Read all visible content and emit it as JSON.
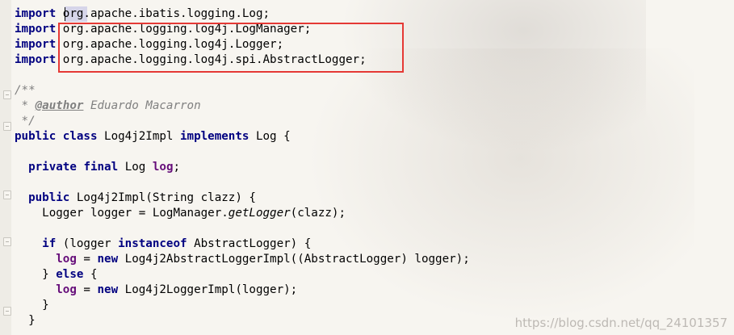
{
  "editor": {
    "lines": [
      [
        {
          "t": "import",
          "c": "kw"
        },
        {
          "t": " org.apache.ibatis.logging.Log;",
          "c": ""
        }
      ],
      [
        {
          "t": "import",
          "c": "kw"
        },
        {
          "t": " org.apache.logging.log4j.LogManager;",
          "c": ""
        }
      ],
      [
        {
          "t": "import",
          "c": "kw"
        },
        {
          "t": " org.apache.logging.log4j.Logger;",
          "c": ""
        }
      ],
      [
        {
          "t": "import",
          "c": "kw"
        },
        {
          "t": " org.apache.logging.log4j.spi.AbstractLogger;",
          "c": ""
        }
      ],
      [],
      [
        {
          "t": "/**",
          "c": "cmt"
        }
      ],
      [
        {
          "t": " * ",
          "c": "cmt"
        },
        {
          "t": "@author",
          "c": "tag"
        },
        {
          "t": " Eduardo Macarron",
          "c": "cmt"
        }
      ],
      [
        {
          "t": " */",
          "c": "cmt"
        }
      ],
      [
        {
          "t": "public",
          "c": "kw"
        },
        {
          "t": " ",
          "c": ""
        },
        {
          "t": "class",
          "c": "kw"
        },
        {
          "t": " Log4j2Impl ",
          "c": ""
        },
        {
          "t": "implements",
          "c": "kw"
        },
        {
          "t": " Log {",
          "c": ""
        }
      ],
      [],
      [
        {
          "t": "  ",
          "c": ""
        },
        {
          "t": "private",
          "c": "kw"
        },
        {
          "t": " ",
          "c": ""
        },
        {
          "t": "final",
          "c": "kw"
        },
        {
          "t": " Log ",
          "c": ""
        },
        {
          "t": "log",
          "c": "field"
        },
        {
          "t": ";",
          "c": ""
        }
      ],
      [],
      [
        {
          "t": "  ",
          "c": ""
        },
        {
          "t": "public",
          "c": "kw"
        },
        {
          "t": " Log4j2Impl(String clazz) {",
          "c": ""
        }
      ],
      [
        {
          "t": "    Logger logger = LogManager.",
          "c": ""
        },
        {
          "t": "getLogger",
          "c": "call"
        },
        {
          "t": "(clazz);",
          "c": ""
        }
      ],
      [],
      [
        {
          "t": "    ",
          "c": ""
        },
        {
          "t": "if",
          "c": "kw"
        },
        {
          "t": " (logger ",
          "c": ""
        },
        {
          "t": "instanceof",
          "c": "kw"
        },
        {
          "t": " AbstractLogger) {",
          "c": ""
        }
      ],
      [
        {
          "t": "      ",
          "c": ""
        },
        {
          "t": "log",
          "c": "field"
        },
        {
          "t": " = ",
          "c": ""
        },
        {
          "t": "new",
          "c": "kw"
        },
        {
          "t": " Log4j2AbstractLoggerImpl((AbstractLogger) logger);",
          "c": ""
        }
      ],
      [
        {
          "t": "    } ",
          "c": ""
        },
        {
          "t": "else",
          "c": "kw"
        },
        {
          "t": " {",
          "c": ""
        }
      ],
      [
        {
          "t": "      ",
          "c": ""
        },
        {
          "t": "log",
          "c": "field"
        },
        {
          "t": " = ",
          "c": ""
        },
        {
          "t": "new",
          "c": "kw"
        },
        {
          "t": " Log4j2LoggerImpl(logger);",
          "c": ""
        }
      ],
      [
        {
          "t": "    }",
          "c": ""
        }
      ],
      [
        {
          "t": "  }",
          "c": ""
        }
      ]
    ]
  },
  "watermark": "https://blog.csdn.net/qq_24101357",
  "colors": {
    "keyword": "#000080",
    "comment": "#808080",
    "field": "#660e7a",
    "highlight_box": "#e53935"
  }
}
